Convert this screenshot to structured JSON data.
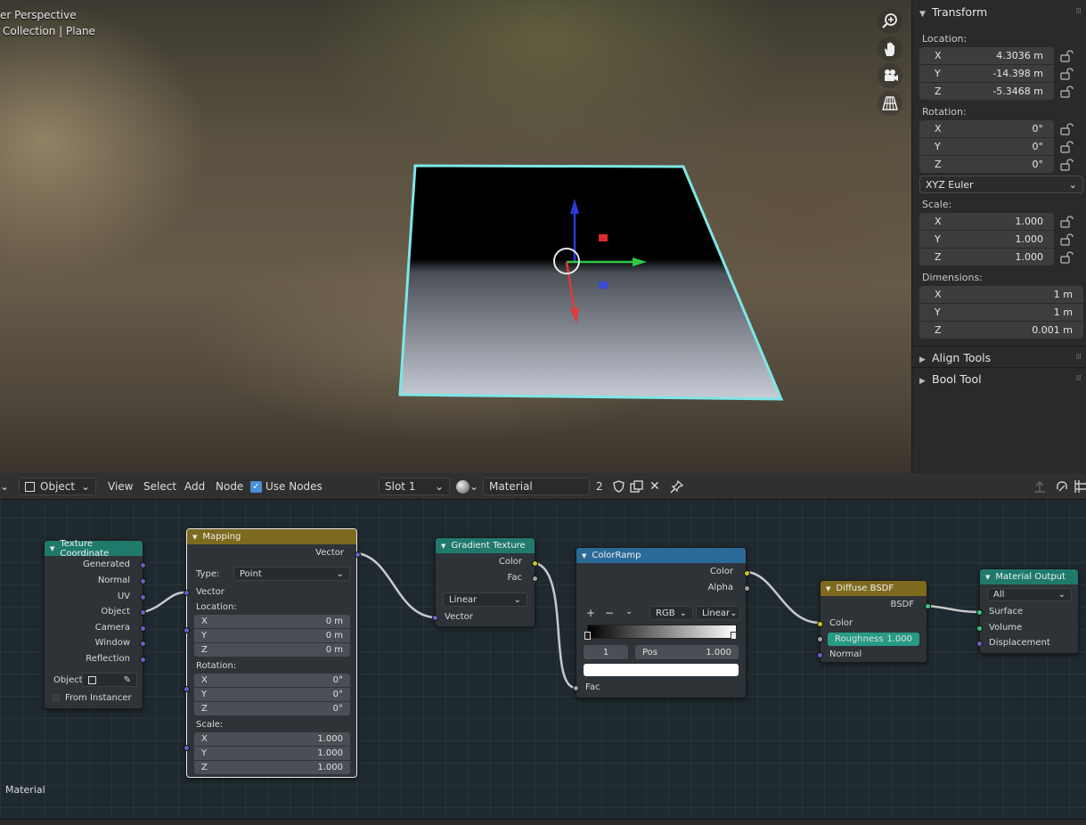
{
  "viewport": {
    "overlay_line1": "er Perspective",
    "overlay_line2": "Collection | Plane",
    "nav_icons": [
      "zoom-icon",
      "pan-hand-icon",
      "camera-icon",
      "perspective-grid-icon"
    ]
  },
  "panel": {
    "transform_title": "Transform",
    "location_label": "Location:",
    "location": [
      {
        "axis": "X",
        "value": "4.3036 m"
      },
      {
        "axis": "Y",
        "value": "-14.398 m"
      },
      {
        "axis": "Z",
        "value": "-5.3468 m"
      }
    ],
    "rotation_label": "Rotation:",
    "rotation": [
      {
        "axis": "X",
        "value": "0°"
      },
      {
        "axis": "Y",
        "value": "0°"
      },
      {
        "axis": "Z",
        "value": "0°"
      }
    ],
    "rotation_mode": "XYZ Euler",
    "scale_label": "Scale:",
    "scale": [
      {
        "axis": "X",
        "value": "1.000"
      },
      {
        "axis": "Y",
        "value": "1.000"
      },
      {
        "axis": "Z",
        "value": "1.000"
      }
    ],
    "dimensions_label": "Dimensions:",
    "dimensions": [
      {
        "axis": "X",
        "value": "1 m"
      },
      {
        "axis": "Y",
        "value": "1 m"
      },
      {
        "axis": "Z",
        "value": "0.001 m"
      }
    ],
    "align_tools": "Align Tools",
    "bool_tool": "Bool Tool"
  },
  "node_header": {
    "mode": "Object",
    "menu": [
      "View",
      "Select",
      "Add",
      "Node"
    ],
    "use_nodes": "Use Nodes",
    "slot": "Slot 1",
    "material_name": "Material",
    "user_count": "2"
  },
  "nodes": {
    "texcoord": {
      "title": "Texture Coordinate",
      "outputs": [
        "Generated",
        "Normal",
        "UV",
        "Object",
        "Camera",
        "Window",
        "Reflection"
      ],
      "object_label": "Object:",
      "from_instancer": "From Instancer"
    },
    "mapping": {
      "title": "Mapping",
      "output": "Vector",
      "type_label": "Type:",
      "type_value": "Point",
      "input_vector": "Vector",
      "location_label": "Location:",
      "location": [
        {
          "axis": "X",
          "value": "0 m"
        },
        {
          "axis": "Y",
          "value": "0 m"
        },
        {
          "axis": "Z",
          "value": "0 m"
        }
      ],
      "rotation_label": "Rotation:",
      "rotation": [
        {
          "axis": "X",
          "value": "0°"
        },
        {
          "axis": "Y",
          "value": "0°"
        },
        {
          "axis": "Z",
          "value": "0°"
        }
      ],
      "scale_label": "Scale:",
      "scale": [
        {
          "axis": "X",
          "value": "1.000"
        },
        {
          "axis": "Y",
          "value": "1.000"
        },
        {
          "axis": "Z",
          "value": "1.000"
        }
      ]
    },
    "gradient": {
      "title": "Gradient Texture",
      "out_color": "Color",
      "out_fac": "Fac",
      "type": "Linear",
      "in_vector": "Vector"
    },
    "colorramp": {
      "title": "ColorRamp",
      "out_color": "Color",
      "out_alpha": "Alpha",
      "plus": "+",
      "minus": "−",
      "color_mode": "RGB",
      "interp": "Linear",
      "stop_index": "1",
      "pos_label": "Pos",
      "pos_value": "1.000",
      "in_fac": "Fac"
    },
    "diffuse": {
      "title": "Diffuse BSDF",
      "out_bsdf": "BSDF",
      "in_color": "Color",
      "roughness_label": "Roughness",
      "roughness_value": "1.000",
      "in_normal": "Normal"
    },
    "output": {
      "title": "Material Output",
      "target": "All",
      "in_surface": "Surface",
      "in_volume": "Volume",
      "in_displacement": "Displacement"
    }
  },
  "footer_label": "Material",
  "colors": {
    "texture_header": "#1f7a6c",
    "converter_header": "#3a7ca8",
    "shader_header": "#8a7a1e",
    "output_header": "#1f7a6c",
    "selection_outline": "#7ee6e6"
  }
}
